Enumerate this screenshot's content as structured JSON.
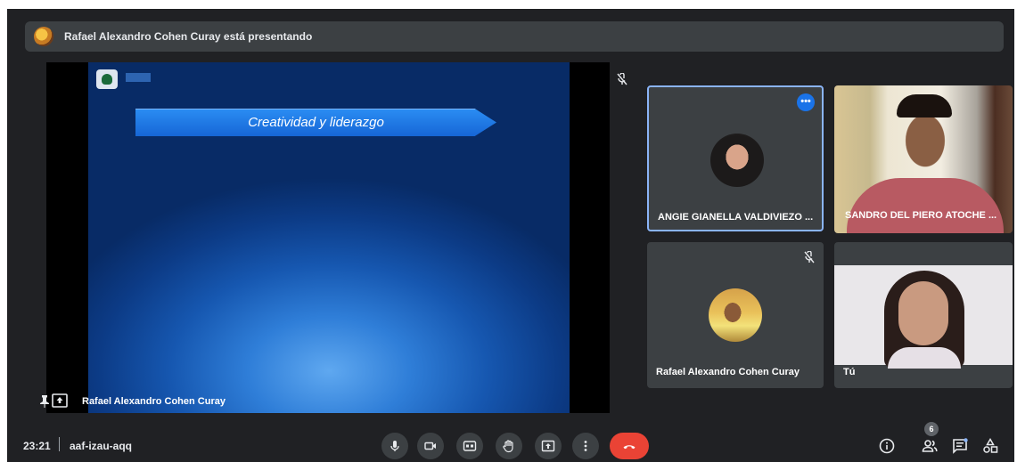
{
  "banner": {
    "text": "Rafael Alexandro Cohen Curay está presentando"
  },
  "stage": {
    "slide_title": "Creatividad y liderazgo",
    "presenter_name": "Rafael Alexandro Cohen Curay"
  },
  "participants": [
    {
      "name": "ANGIE GIANELLA VALDIVIEZO ...",
      "more_label": "•••"
    },
    {
      "name": "SANDRO DEL PIERO ATOCHE ..."
    },
    {
      "name": "Rafael Alexandro Cohen Curay"
    },
    {
      "name": "Tú"
    }
  ],
  "bottom_bar": {
    "time": "23:21",
    "meeting_code": "aaf-izau-aqq",
    "participant_count": "6"
  },
  "colors": {
    "background": "#202124",
    "tile": "#3c4043",
    "accent": "#8ab4f8",
    "hangup": "#ea4335"
  },
  "icons": {
    "controls": [
      "mic-icon",
      "camera-icon",
      "captions-icon",
      "raise-hand-icon",
      "present-icon",
      "more-vert-icon",
      "end-call-icon"
    ],
    "right": [
      "info-icon",
      "people-icon",
      "chat-icon",
      "activities-icon"
    ]
  }
}
